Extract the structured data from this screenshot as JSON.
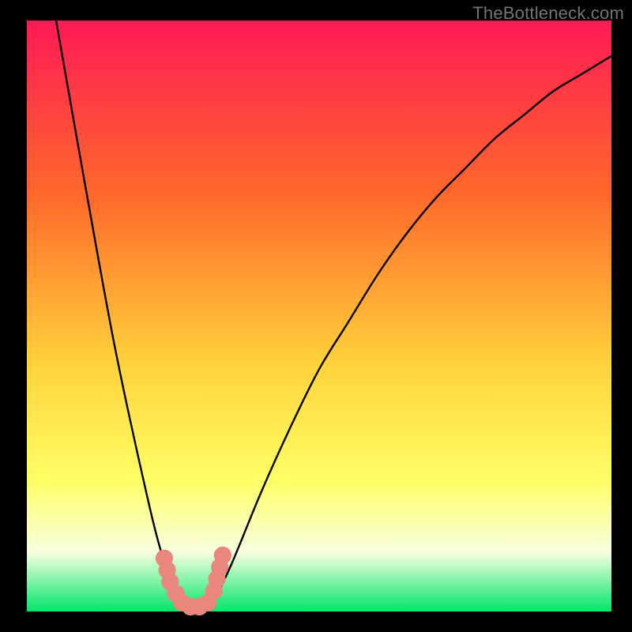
{
  "watermark": "TheBottleneck.com",
  "colors": {
    "gradient_top": "#ff1a55",
    "gradient_mid1": "#ff6a2a",
    "gradient_mid2": "#ffd23a",
    "gradient_mid3": "#ffff66",
    "gradient_bottom_pale": "#f8ffe0",
    "gradient_green": "#00e66a",
    "curve_stroke": "#000000",
    "marker_fill": "#e9877c",
    "background": "#000000"
  },
  "chart_data": {
    "type": "line",
    "title": "",
    "xlabel": "",
    "ylabel": "",
    "xlim": [
      0,
      100
    ],
    "ylim": [
      0,
      100
    ],
    "curve": {
      "comment": "V-shaped bottleneck curve; y is the plotted height (0 at bottom, 100 at top). Minimum (~0) around x≈26–31.",
      "x": [
        5,
        10,
        15,
        20,
        23,
        26,
        28,
        30,
        32,
        35,
        40,
        45,
        50,
        55,
        60,
        65,
        70,
        75,
        80,
        85,
        90,
        95,
        100
      ],
      "y": [
        100,
        72,
        45,
        22,
        10,
        2,
        0,
        0,
        2,
        8,
        20,
        31,
        41,
        49,
        57,
        64,
        70,
        75,
        80,
        84,
        88,
        91,
        94
      ]
    },
    "markers": {
      "comment": "Salmon dot clusters near the curve minimum on both flanks.",
      "points": [
        {
          "x": 23.5,
          "y": 9
        },
        {
          "x": 24.0,
          "y": 7
        },
        {
          "x": 24.5,
          "y": 5
        },
        {
          "x": 25.5,
          "y": 3
        },
        {
          "x": 26.5,
          "y": 1.5
        },
        {
          "x": 28.0,
          "y": 0.8
        },
        {
          "x": 29.5,
          "y": 0.8
        },
        {
          "x": 31.0,
          "y": 1.5
        },
        {
          "x": 32.0,
          "y": 3.5
        },
        {
          "x": 32.5,
          "y": 5.5
        },
        {
          "x": 33.0,
          "y": 7.5
        },
        {
          "x": 33.5,
          "y": 9.5
        }
      ],
      "radius": 1.5
    }
  }
}
